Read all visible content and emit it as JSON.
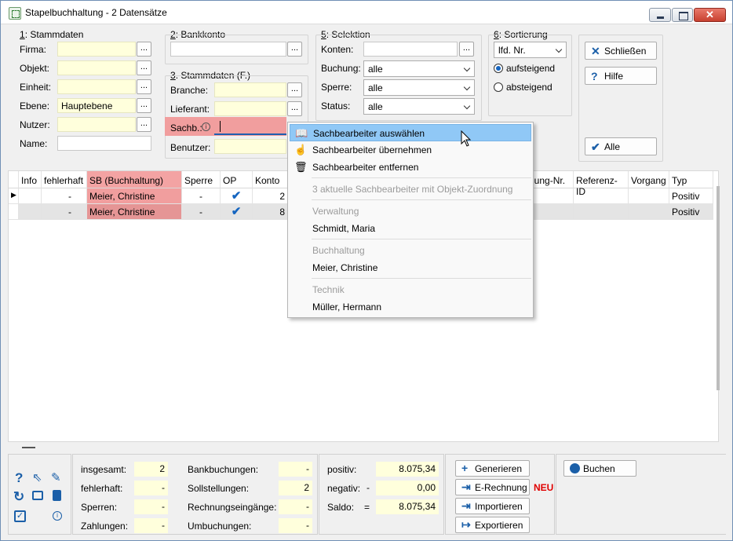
{
  "window": {
    "title": "Stapelbuchhaltung - 2 Datensätze"
  },
  "stammdaten": {
    "heading_num": "1",
    "heading": ": Stammdaten",
    "firma": "Firma:",
    "objekt": "Objekt:",
    "einheit": "Einheit:",
    "ebene": "Ebene:",
    "ebene_value": "Hauptebene",
    "nutzer": "Nutzer:",
    "name": "Name:"
  },
  "bankkonto": {
    "heading_num": "2",
    "heading": ": Bankkonto"
  },
  "stammdaten_f": {
    "heading_num": "3",
    "heading": ". Stammdaten (F.)",
    "branche": "Branche:",
    "lieferant": "Lieferant:",
    "sachb": "Sachb.:",
    "benutzer": "Benutzer:"
  },
  "selektion": {
    "heading_num": "5",
    "heading": ": Selektion",
    "konten": "Konten:",
    "buchung": "Buchung:",
    "buchung_value": "alle",
    "sperre": "Sperre:",
    "sperre_value": "alle",
    "status": "Status:",
    "status_value": "alle"
  },
  "sortierung": {
    "heading_num": "6",
    "heading": ": Sortierung",
    "value": "lfd. Nr.",
    "asc": "aufsteigend",
    "desc": "absteigend"
  },
  "actions": {
    "close": "Schließen",
    "help": "Hilfe",
    "all": "Alle"
  },
  "grid": {
    "headers": [
      "Info",
      "fehlerhaft",
      "SB (Buchhaltung)",
      "Sperre",
      "OP",
      "Konto",
      "nung-Nr.",
      "Referenz-ID",
      "Vorgang",
      "Typ"
    ],
    "rows": [
      {
        "fehlerhaft": "-",
        "sb": "Meier, Christine",
        "sperre": "-",
        "op": "✔",
        "konto": "2",
        "typ": "Positiv"
      },
      {
        "fehlerhaft": "-",
        "sb": "Meier, Christine",
        "sperre": "-",
        "op": "✔",
        "konto": "8",
        "typ": "Positiv"
      }
    ]
  },
  "context_menu": {
    "select": "Sachbearbeiter auswählen",
    "take": "Sachbearbeiter übernehmen",
    "remove": "Sachbearbeiter entfernen",
    "current": "3 aktuelle Sachbearbeiter mit Objekt-Zuordnung",
    "group1": "Verwaltung",
    "person1": "Schmidt, Maria",
    "group2": "Buchhaltung",
    "person2": "Meier, Christine",
    "group3": "Technik",
    "person3": "Müller, Hermann"
  },
  "summary": {
    "insgesamt": "insgesamt:",
    "insgesamt_v": "2",
    "fehlerhaft": "fehlerhaft:",
    "fehlerhaft_v": "-",
    "sperren": "Sperren:",
    "sperren_v": "-",
    "zahlungen": "Zahlungen:",
    "zahlungen_v": "-",
    "bank": "Bankbuchungen:",
    "bank_v": "-",
    "soll": "Sollstellungen:",
    "soll_v": "2",
    "rechnung": "Rechnungseingänge:",
    "rechnung_v": "-",
    "umbuchungen": "Umbuchungen:",
    "umbuchungen_v": "-",
    "positiv": "positiv:",
    "positiv_v": "8.075,34",
    "negativ": "negativ:",
    "negativ_sign": "-",
    "negativ_v": "0,00",
    "saldo": "Saldo:",
    "saldo_sign": "=",
    "saldo_v": "8.075,34"
  },
  "bottom_actions": {
    "generieren": "Generieren",
    "erechnung": "E-Rechnung",
    "neu": "NEU",
    "importieren": "Importieren",
    "exportieren": "Exportieren",
    "buchen": "Buchen"
  }
}
